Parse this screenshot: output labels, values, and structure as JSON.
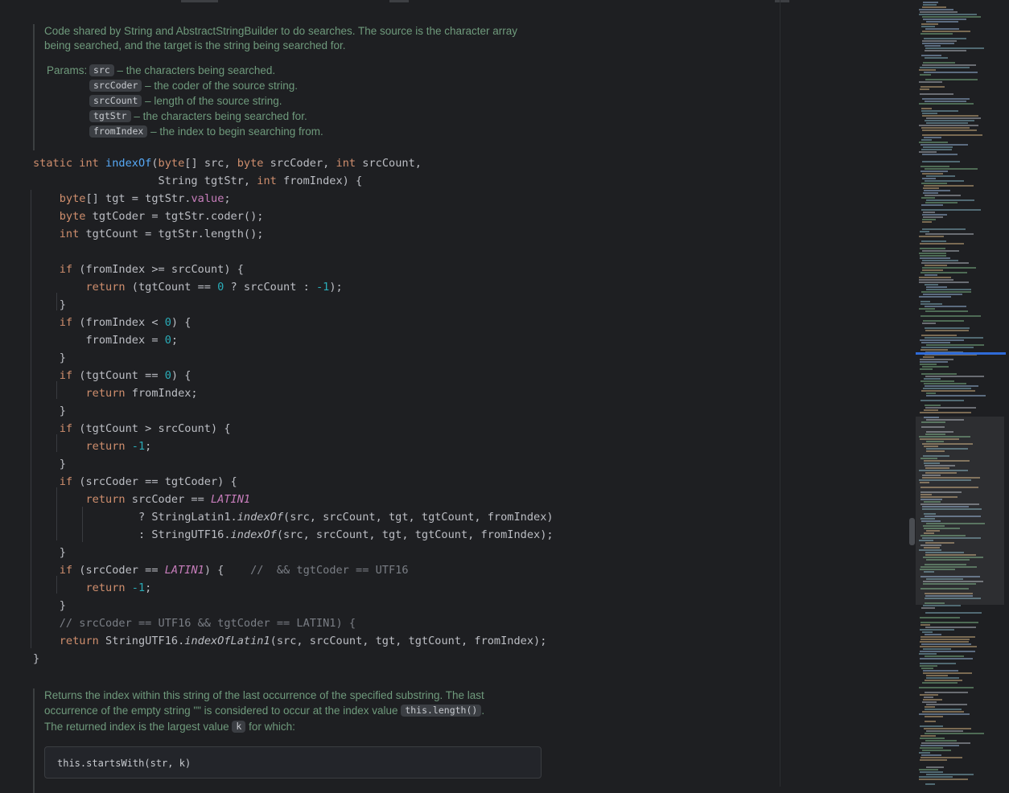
{
  "doc1": {
    "description": "Code shared by String and AbstractStringBuilder to do searches. The source is the character array being searched, and the target is the string being searched for.",
    "params_label": "Params:",
    "params": [
      {
        "name": "src",
        "desc": "– the characters being searched."
      },
      {
        "name": "srcCoder",
        "desc": "– the coder of the source string."
      },
      {
        "name": "srcCount",
        "desc": "– length of the source string."
      },
      {
        "name": "tgtStr",
        "desc": "– the characters being searched for."
      },
      {
        "name": "fromIndex",
        "desc": "– the index to begin searching from."
      }
    ]
  },
  "code": [
    [
      [
        "static int ",
        "kw"
      ],
      [
        "indexOf",
        "fn"
      ],
      [
        "(",
        ""
      ],
      [
        "byte",
        "kw"
      ],
      [
        "[] src, ",
        ""
      ],
      [
        "byte",
        "kw"
      ],
      [
        " srcCoder, ",
        ""
      ],
      [
        "int",
        "kw"
      ],
      [
        " srcCount,",
        ""
      ]
    ],
    [
      [
        "                   String tgtStr, ",
        ""
      ],
      [
        "int",
        "kw"
      ],
      [
        " fromIndex) {",
        ""
      ]
    ],
    [
      [
        "    ",
        ""
      ],
      [
        "byte",
        "kw"
      ],
      [
        "[] tgt = tgtStr.",
        ""
      ],
      [
        "value",
        "fld"
      ],
      [
        ";",
        ""
      ]
    ],
    [
      [
        "    ",
        ""
      ],
      [
        "byte",
        "kw"
      ],
      [
        " tgtCoder = tgtStr.coder();",
        ""
      ]
    ],
    [
      [
        "    ",
        ""
      ],
      [
        "int",
        "kw"
      ],
      [
        " tgtCount = tgtStr.length();",
        ""
      ]
    ],
    [
      [
        "",
        ""
      ]
    ],
    [
      [
        "    ",
        ""
      ],
      [
        "if",
        "kw"
      ],
      [
        " (fromIndex >= srcCount) {",
        ""
      ]
    ],
    [
      [
        "        ",
        ""
      ],
      [
        "return",
        "kw"
      ],
      [
        " (tgtCount == ",
        ""
      ],
      [
        "0",
        "num"
      ],
      [
        " ? srcCount : ",
        ""
      ],
      [
        "-1",
        "num"
      ],
      [
        ");",
        ""
      ]
    ],
    [
      [
        "    }",
        ""
      ]
    ],
    [
      [
        "    ",
        ""
      ],
      [
        "if",
        "kw"
      ],
      [
        " (fromIndex < ",
        ""
      ],
      [
        "0",
        "num"
      ],
      [
        ") {",
        ""
      ]
    ],
    [
      [
        "        fromIndex = ",
        ""
      ],
      [
        "0",
        "num"
      ],
      [
        ";",
        ""
      ]
    ],
    [
      [
        "    }",
        ""
      ]
    ],
    [
      [
        "    ",
        ""
      ],
      [
        "if",
        "kw"
      ],
      [
        " (tgtCount == ",
        ""
      ],
      [
        "0",
        "num"
      ],
      [
        ") {",
        ""
      ]
    ],
    [
      [
        "        ",
        ""
      ],
      [
        "return",
        "kw"
      ],
      [
        " fromIndex;",
        ""
      ]
    ],
    [
      [
        "    }",
        ""
      ]
    ],
    [
      [
        "    ",
        ""
      ],
      [
        "if",
        "kw"
      ],
      [
        " (tgtCount > srcCount) {",
        ""
      ]
    ],
    [
      [
        "        ",
        ""
      ],
      [
        "return",
        "kw"
      ],
      [
        " ",
        ""
      ],
      [
        "-1",
        "num"
      ],
      [
        ";",
        ""
      ]
    ],
    [
      [
        "    }",
        ""
      ]
    ],
    [
      [
        "    ",
        ""
      ],
      [
        "if",
        "kw"
      ],
      [
        " (srcCoder == tgtCoder) {",
        ""
      ]
    ],
    [
      [
        "        ",
        ""
      ],
      [
        "return",
        "kw"
      ],
      [
        " srcCoder == ",
        ""
      ],
      [
        "LATIN1",
        "st"
      ]
    ],
    [
      [
        "                ? StringLatin1.",
        ""
      ],
      [
        "indexOf",
        "it"
      ],
      [
        "(src, srcCount, tgt, tgtCount, fromIndex)",
        ""
      ]
    ],
    [
      [
        "                : StringUTF16.",
        ""
      ],
      [
        "indexOf",
        "it"
      ],
      [
        "(src, srcCount, tgt, tgtCount, fromIndex);",
        ""
      ]
    ],
    [
      [
        "    }",
        ""
      ]
    ],
    [
      [
        "    ",
        ""
      ],
      [
        "if",
        "kw"
      ],
      [
        " (srcCoder == ",
        ""
      ],
      [
        "LATIN1",
        "st"
      ],
      [
        ") {    ",
        ""
      ],
      [
        "//  && tgtCoder == UTF16",
        "cm"
      ]
    ],
    [
      [
        "        ",
        ""
      ],
      [
        "return",
        "kw"
      ],
      [
        " ",
        ""
      ],
      [
        "-1",
        "num"
      ],
      [
        ";",
        ""
      ]
    ],
    [
      [
        "    }",
        ""
      ]
    ],
    [
      [
        "    ",
        ""
      ],
      [
        "// srcCoder == UTF16 && tgtCoder == LATIN1) {",
        "cm"
      ]
    ],
    [
      [
        "    ",
        ""
      ],
      [
        "return",
        "kw"
      ],
      [
        " StringUTF16.",
        ""
      ],
      [
        "indexOfLatin1",
        "it"
      ],
      [
        "(src, srcCount, tgt, tgtCount, fromIndex);",
        ""
      ]
    ],
    [
      [
        "}",
        ""
      ]
    ]
  ],
  "doc2": {
    "line1": "Returns the index within this string of the last occurrence of the specified substring. The last",
    "line2_pre": "occurrence of the empty string \"\" is considered to occur at the index value ",
    "line2_code": "this.length()",
    "line2_post": ".",
    "line3_pre": "The returned index is the largest value ",
    "line3_code": "k",
    "line3_post": " for which:",
    "example_code": "this.startsWith(str, k)"
  }
}
